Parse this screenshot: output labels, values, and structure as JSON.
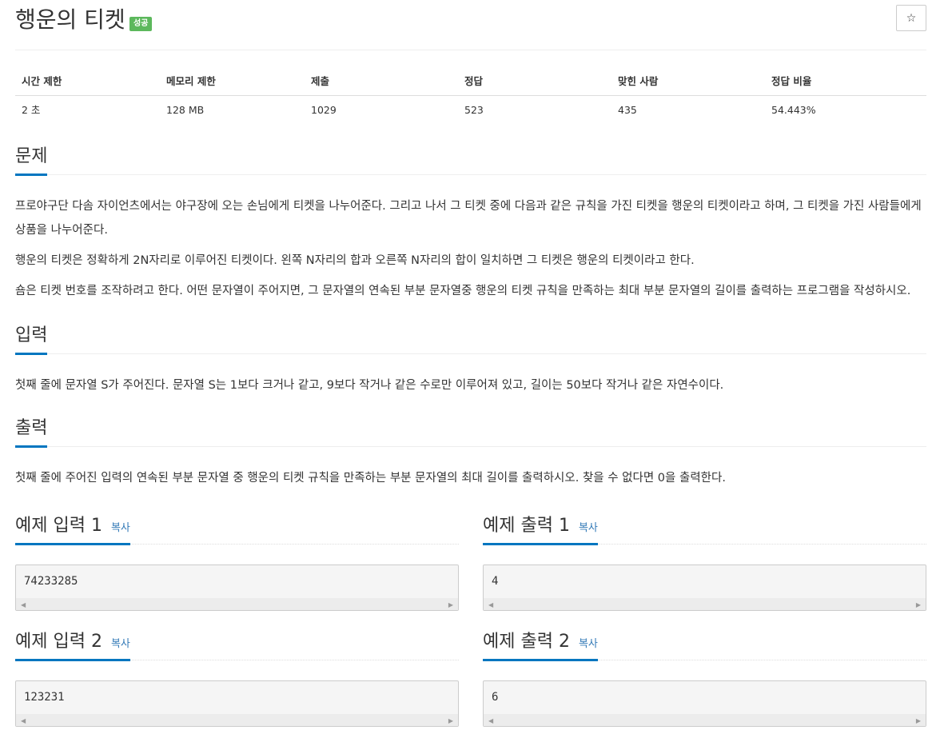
{
  "problem": {
    "title": "행운의 티켓",
    "badge": "성공",
    "star_icon": "☆"
  },
  "stats": {
    "headers": [
      "시간 제한",
      "메모리 제한",
      "제출",
      "정답",
      "맞힌 사람",
      "정답 비율"
    ],
    "values": [
      "2 초",
      "128 MB",
      "1029",
      "523",
      "435",
      "54.443%"
    ]
  },
  "description": {
    "heading": "문제",
    "paragraphs": [
      "프로야구단 다솜 자이언츠에서는 야구장에 오는 손님에게 티켓을 나누어준다. 그리고 나서 그 티켓 중에 다음과 같은 규칙을 가진 티켓을 행운의 티켓이라고 하며, 그 티켓을 가진 사람들에게 상품을 나누어준다.",
      "행운의 티켓은 정확하게 2N자리로 이루어진 티켓이다. 왼쪽 N자리의 합과 오른쪽 N자리의 합이 일치하면 그 티켓은 행운의 티켓이라고 한다.",
      "숌은 티켓 번호를 조작하려고 한다. 어떤 문자열이 주어지면, 그 문자열의 연속된 부분 문자열중 행운의 티켓 규칙을 만족하는 최대 부분 문자열의 길이를 출력하는 프로그램을 작성하시오."
    ]
  },
  "input": {
    "heading": "입력",
    "text": "첫째 줄에 문자열 S가 주어진다. 문자열 S는 1보다 크거나 같고, 9보다 작거나 같은 수로만 이루어져 있고, 길이는 50보다 작거나 같은 자연수이다."
  },
  "output": {
    "heading": "출력",
    "text": "첫째 줄에 주어진 입력의 연속된 부분 문자열 중 행운의 티켓 규칙을 만족하는 부분 문자열의 최대 길이를 출력하시오. 찾을 수 없다면 0을 출력한다."
  },
  "samples": [
    {
      "in_heading": "예제 입력 1",
      "in_value": "74233285",
      "out_heading": "예제 출력 1",
      "out_value": "4",
      "copy_label": "복사"
    },
    {
      "in_heading": "예제 입력 2",
      "in_value": "123231",
      "out_heading": "예제 출력 2",
      "out_value": "6",
      "copy_label": "복사"
    }
  ],
  "colors": {
    "accent": "#0076c0",
    "badge": "#5cb85c",
    "link": "#337ab7"
  }
}
